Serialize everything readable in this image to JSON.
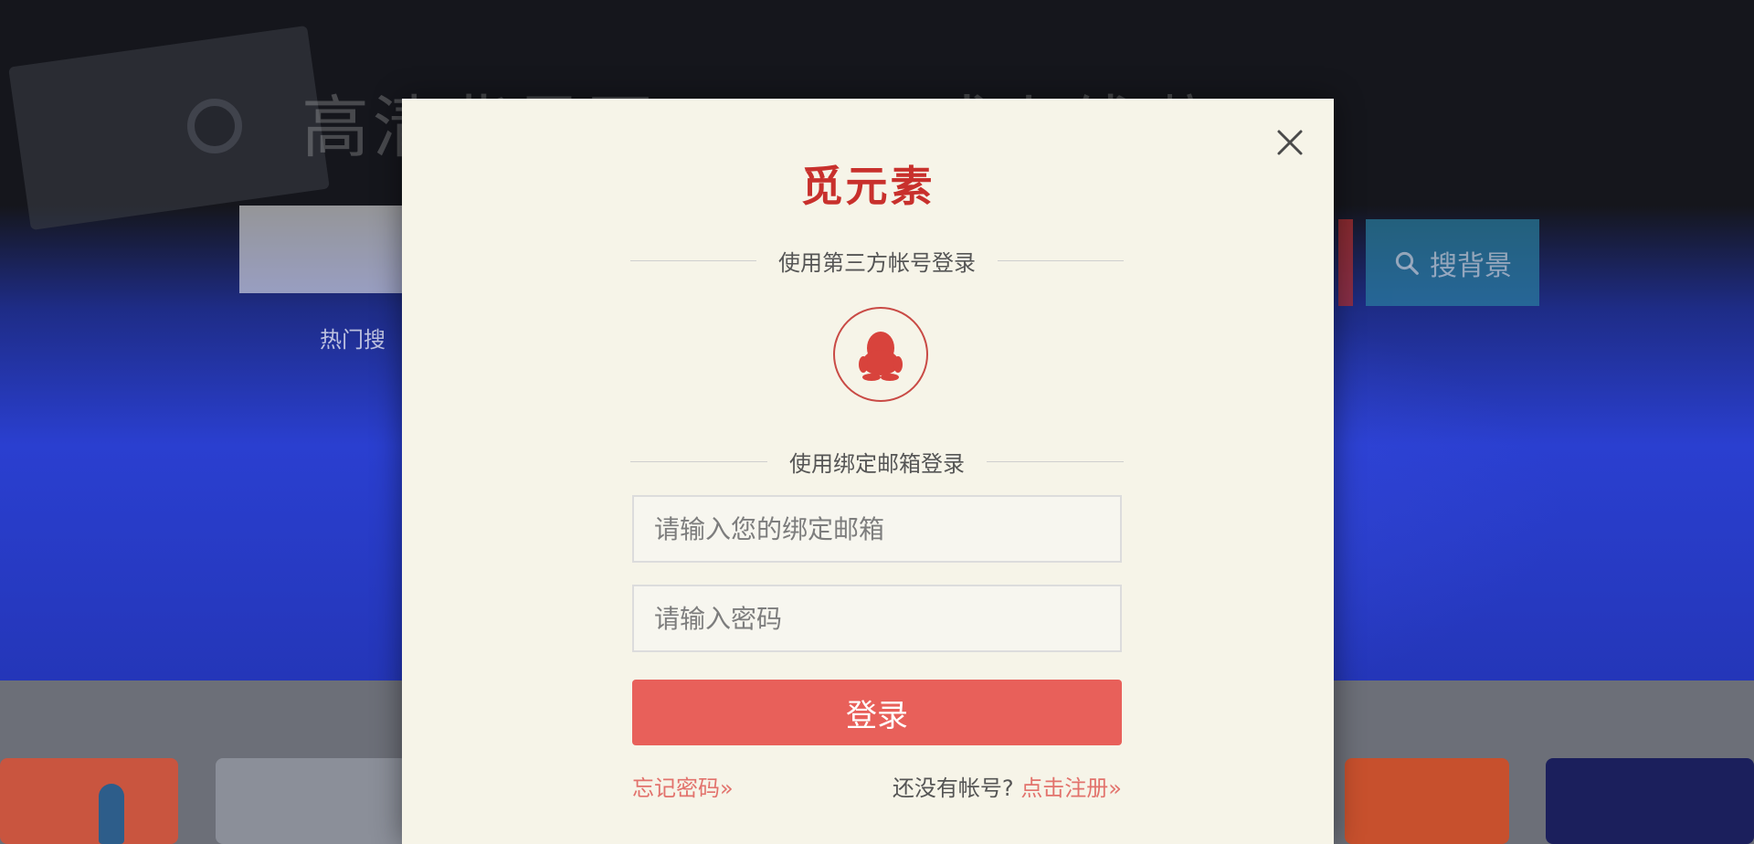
{
  "background": {
    "headline": "高清背景图 PSD 正式上线啦",
    "search_button_label": "搜背景",
    "hot_search_label": "热门搜"
  },
  "modal": {
    "brand": "觅元素",
    "third_party_heading": "使用第三方帐号登录",
    "qq_icon": "qq-penguin-icon",
    "email_heading": "使用绑定邮箱登录",
    "email_placeholder": "请输入您的绑定邮箱",
    "password_placeholder": "请输入密码",
    "login_button": "登录",
    "forgot_password": "忘记密码»",
    "no_account": "还没有帐号?",
    "register": "点击注册»",
    "close_icon": "close-icon"
  },
  "colors": {
    "brand": "#c8302c",
    "primary_button": "#e8605a",
    "link": "#e2726c",
    "modal_bg": "#f6f4e8"
  }
}
